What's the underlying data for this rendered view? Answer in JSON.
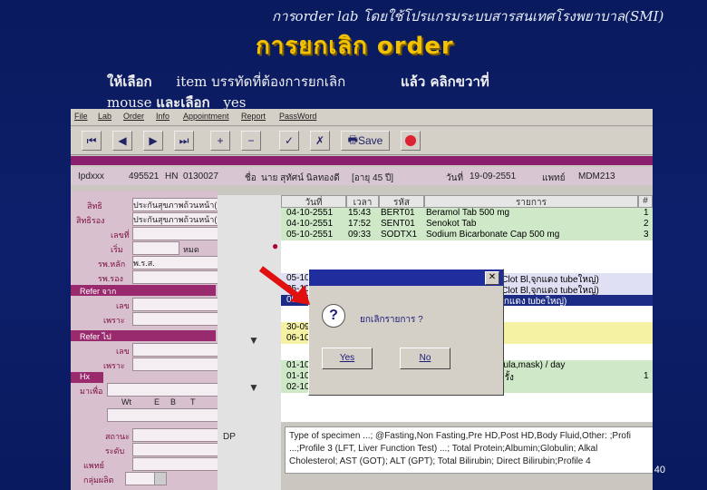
{
  "slide": {
    "header": "การorder lab โดยใช้โปรแกรมระบบสารสนเทศโรงพยาบาล(SMI)",
    "title": "การยกเลิก order",
    "instr1_a": "ให้เลือก",
    "instr1_b": "item บรรทัดที่ต้องการยกเลิก",
    "instr1_c": "แล้ว คลิกขวาที่",
    "instr2_a": "mouse",
    "instr2_b": "และเลือก",
    "instr2_c": "yes",
    "page_number": "40"
  },
  "menu": [
    "File",
    "Lab",
    "Order",
    "Info",
    "Appointment",
    "Report",
    "PassWord"
  ],
  "toolbar": {
    "save_label": "Save"
  },
  "patient": {
    "prefix": "Ipdxxx",
    "id": "495521",
    "hn_label": "HN",
    "hn": "0130027",
    "name_label": "ชื่อ",
    "name": "นาย สุทัศน์ นิลทองดี",
    "age": "[อายุ 45 ปี]",
    "date_label": "วันที่",
    "date": "19-09-2551",
    "doctor_label": "แพทย์",
    "doctor": "MDM213"
  },
  "left_fields": [
    {
      "label": "สิทธิ",
      "value": "ประกันสุขภาพถ้วนหน้า(สปส.)"
    },
    {
      "label": "สิทธิรอง",
      "value": "ประกันสุขภาพถ้วนหน้า(สปส.)"
    },
    {
      "label": "เลขที่",
      "value": ""
    },
    {
      "label": "เริ่ม",
      "value": "หมด"
    },
    {
      "label": "รพ.หลัก",
      "value": "พ.ร.ส."
    },
    {
      "label": "รพ.รอง",
      "value": ""
    }
  ],
  "sections": {
    "refer_from": "Refer จาก",
    "refer_to": "Refer ไป",
    "hx": "Hx",
    "number_label": "เลข",
    "reason_label": "เพราะ",
    "came_for": "มาเพื่อ",
    "wt": "Wt",
    "e": "E",
    "b": "B",
    "t": "T",
    "status": "สถานะ",
    "level": "ระดับ",
    "doctor_order": "แพทย์",
    "group": "กลุ่มผลิต",
    "dp": "DP"
  },
  "orders": {
    "headers": [
      "วันที่",
      "เวลา",
      "รหัส",
      "รายการ",
      "#"
    ],
    "rows": [
      {
        "date": "04-10-2551",
        "time": "15:43",
        "code": "BERT01",
        "item": "Beramol Tab 500 mg",
        "qty": "1"
      },
      {
        "date": "04-10-2551",
        "time": "17:52",
        "code": "SENT01",
        "item": "Senokot Tab",
        "qty": "2"
      },
      {
        "date": "05-10-2551",
        "time": "09:33",
        "code": "SODTX1",
        "item": "Sodium Bicarbonate Cap 500 mg",
        "qty": "3"
      },
      {
        "date": "05-10-255",
        "time": "",
        "code": "",
        "item": "(Clot Bl,จุกแดง tubeใหญ่)",
        "qty": ""
      },
      {
        "date": "05-10-255",
        "time": "",
        "code": "",
        "item": "(Clot Bl,จุกแดง tubeใหญ่)",
        "qty": ""
      },
      {
        "date": "05-10-255",
        "time": "",
        "code": "",
        "item": "จุกแดง tubeใหญ่)",
        "qty": ""
      },
      {
        "date": "30-09-255",
        "time": "",
        "code": "",
        "item": "",
        "qty": ""
      },
      {
        "date": "06-10-255",
        "time": "",
        "code": "",
        "item": "",
        "qty": ""
      },
      {
        "date": "01-10-255",
        "time": "",
        "code": "",
        "item": "nula,mask) / day",
        "qty": ""
      },
      {
        "date": "01-10-255",
        "time": "",
        "code": "",
        "item": "ครั้ง",
        "qty": "1"
      },
      {
        "date": "02-10-255",
        "time": "",
        "code": "",
        "item": "",
        "qty": ""
      }
    ]
  },
  "dialog": {
    "message": "ยกเลิกรายการ ?",
    "yes": "Yes",
    "no": "No",
    "close": "✕"
  },
  "specimen": {
    "line1": "Type of specimen ...; @Fasting,Non Fasting,Pre HD,Post HD,Body Fluid,Other: ;Profi",
    "line2": "...;Profile 3 (LFT, Liver Function Test) ...;      Total Protein;Albumin;Globulin;  Alkal",
    "line3": "Cholesterol;  AST (GOT);  ALT (GPT);  Total Bilirubin;  Direct Bilirubin;Profile 4"
  }
}
